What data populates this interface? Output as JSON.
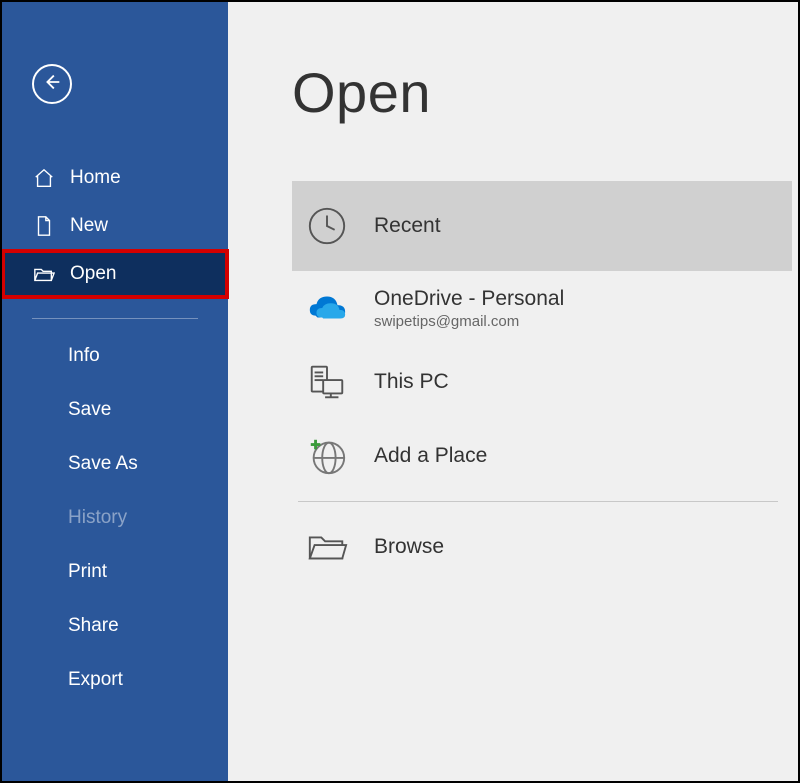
{
  "sidebar": {
    "home_label": "Home",
    "new_label": "New",
    "open_label": "Open",
    "info_label": "Info",
    "save_label": "Save",
    "saveas_label": "Save As",
    "history_label": "History",
    "print_label": "Print",
    "share_label": "Share",
    "export_label": "Export"
  },
  "main": {
    "title": "Open",
    "recent_label": "Recent",
    "onedrive_label": "OneDrive - Personal",
    "onedrive_account": "swipetips@gmail.com",
    "thispc_label": "This PC",
    "addplace_label": "Add a Place",
    "browse_label": "Browse"
  }
}
